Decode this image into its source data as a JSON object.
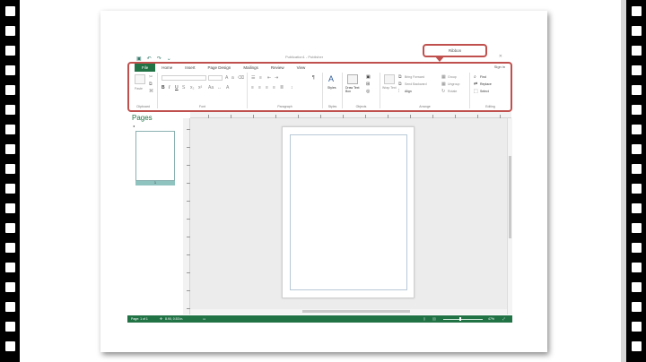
{
  "app": {
    "title": "Publication1 - Publisher",
    "window_controls": "? – ▫ ✕"
  },
  "callout": {
    "label": "Ribbon"
  },
  "quick_access": [
    {
      "icon": "save-icon",
      "glyph": "💾"
    },
    {
      "icon": "undo-icon",
      "glyph": "↶"
    },
    {
      "icon": "redo-icon",
      "glyph": "↷"
    },
    {
      "icon": "customize-icon",
      "glyph": "⌄"
    }
  ],
  "ribbon": {
    "tabs": [
      {
        "label": "File",
        "active": true
      },
      {
        "label": "Home"
      },
      {
        "label": "Insert"
      },
      {
        "label": "Page Design"
      },
      {
        "label": "Mailings"
      },
      {
        "label": "Review"
      },
      {
        "label": "View"
      }
    ],
    "signin": "Sign in",
    "groups": {
      "clipboard": "Clipboard",
      "font": "Font",
      "paragraph": "Paragraph",
      "styles": "Styles",
      "objects": "Objects",
      "arrange": "Arrange",
      "editing": "Editing"
    },
    "buttons": {
      "paste": "Paste",
      "styles": "Styles",
      "draw_text_box": "Draw Text Box",
      "wrap_text": "Wrap Text",
      "bring_forward": "Bring Forward",
      "send_backward": "Send Backward",
      "align": "Align",
      "group": "Group",
      "ungroup": "Ungroup",
      "rotate": "Rotate",
      "find": "Find",
      "replace": "Replace",
      "select": "Select"
    }
  },
  "pages_pane": {
    "title": "Pages",
    "page_number": "1"
  },
  "status": {
    "page": "Page: 1 of 1",
    "position": "8.90, 0.53 in.",
    "zoom": "47%"
  },
  "colors": {
    "accent": "#217346",
    "callout_border": "#c0504d"
  }
}
